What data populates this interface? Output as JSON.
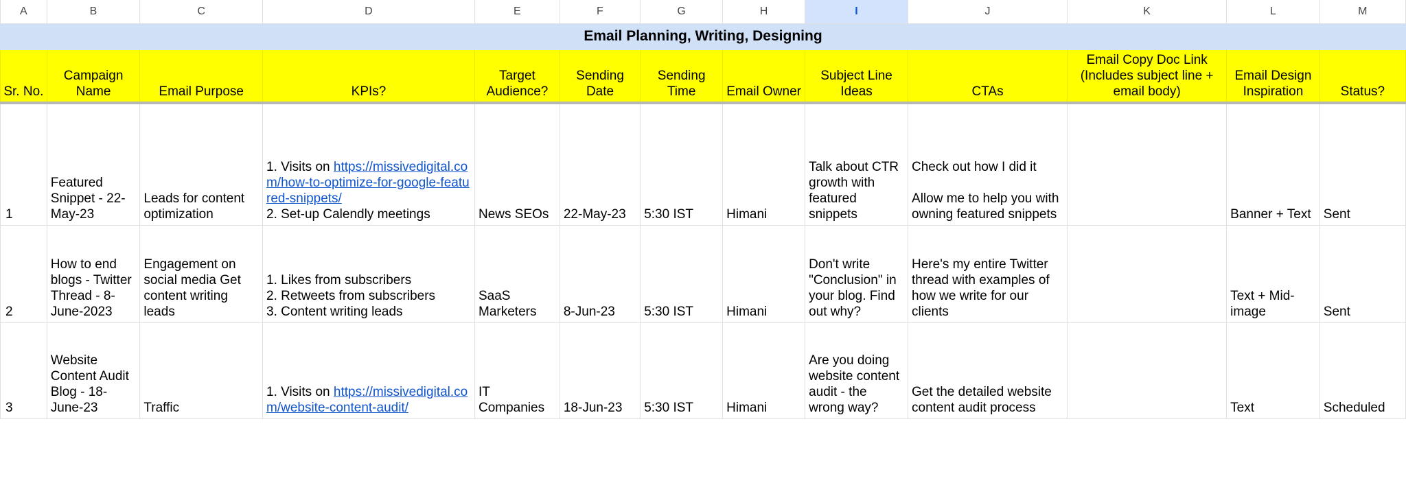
{
  "app": {
    "type": "spreadsheet"
  },
  "columns": {
    "letters": [
      "A",
      "B",
      "C",
      "D",
      "E",
      "F",
      "G",
      "H",
      "I",
      "J",
      "K",
      "L",
      "M"
    ],
    "selected": "I"
  },
  "title_banner": {
    "text": "Email Planning, Writing, Designing",
    "background": "#cfe0f7"
  },
  "header": {
    "background": "#ffff00",
    "cells": [
      "Sr. No.",
      "Campaign Name",
      "Email Purpose",
      "KPIs?",
      "Target Audience?",
      "Sending Date",
      "Sending Time",
      "Email Owner",
      "Subject Line Ideas",
      "CTAs",
      "Email Copy Doc Link (Includes subject line + email body)",
      "Email Design Inspiration",
      "Status?"
    ]
  },
  "rows": [
    {
      "sr_no": "1",
      "campaign_name": "Featured Snippet - 22-May-23",
      "email_purpose": "Leads for content optimization",
      "kpis_pre": "1. Visits on ",
      "kpis_link": "https://missivedigital.com/how-to-optimize-for-google-featured-snippets/",
      "kpis_post": "2. Set-up Calendly meetings",
      "target_audience": "News SEOs",
      "sending_date": "22-May-23",
      "sending_time": "5:30 IST",
      "email_owner": "Himani",
      "subject_line_ideas": "Talk about CTR growth with featured snippets",
      "ctas": "Check out how I did it\n\nAllow me to help you with owning featured snippets",
      "email_copy_doc_link": "",
      "email_design_inspiration": "Banner + Text",
      "status": "Sent"
    },
    {
      "sr_no": "2",
      "campaign_name": "How to end blogs - Twitter Thread - 8-June-2023",
      "email_purpose": "Engagement on social media Get content writing leads",
      "kpis_pre": "1. Likes from subscribers\n2. Retweets from subscribers\n3. Content writing leads",
      "kpis_link": "",
      "kpis_post": "",
      "target_audience": "SaaS Marketers",
      "sending_date": "8-Jun-23",
      "sending_time": "5:30 IST",
      "email_owner": "Himani",
      "subject_line_ideas": "Don't write \"Conclusion\" in your blog. Find out why?",
      "ctas": "Here's my entire Twitter thread with examples of how we write for our clients",
      "email_copy_doc_link": "",
      "email_design_inspiration": "Text + Mid-image",
      "status": "Sent"
    },
    {
      "sr_no": "3",
      "campaign_name": "Website Content Audit Blog - 18-June-23",
      "email_purpose": "Traffic",
      "kpis_pre": "1. Visits on ",
      "kpis_link": "https://missivedigital.com/website-content-audit/",
      "kpis_post": "",
      "target_audience": "IT Companies",
      "sending_date": "18-Jun-23",
      "sending_time": "5:30 IST",
      "email_owner": "Himani",
      "subject_line_ideas": "Are you doing website content audit - the wrong way?",
      "ctas": "Get the detailed website content audit process",
      "email_copy_doc_link": "",
      "email_design_inspiration": "Text",
      "status": "Scheduled"
    }
  ]
}
